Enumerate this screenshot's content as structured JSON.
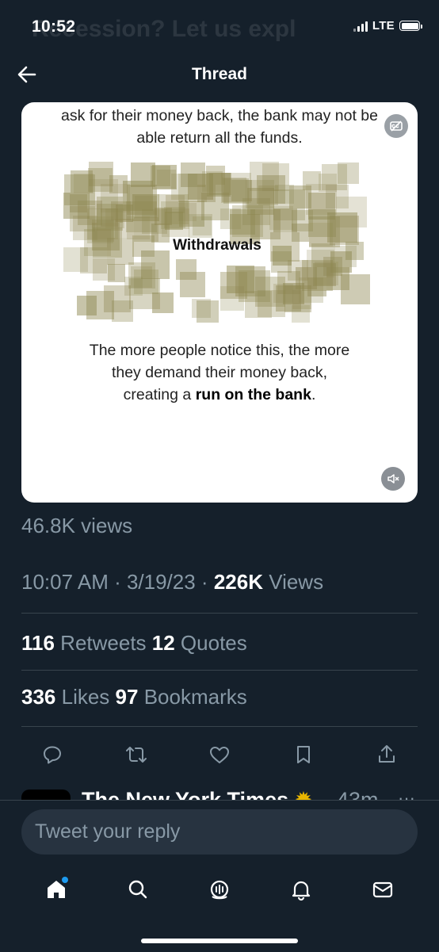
{
  "status": {
    "time": "10:52",
    "network": "LTE"
  },
  "header": {
    "title": "Thread"
  },
  "media": {
    "text_top": "ask for their money back, the bank may not be able return all the funds.",
    "grid_label": "Withdrawals",
    "text_bottom_1": "The more people notice this, the more they demand their money back, creating a ",
    "text_bottom_bold": "run on the bank",
    "text_bottom_end": "."
  },
  "stats": {
    "media_views": "46.8K views",
    "timestamp": "10:07 AM · 3/19/23 · ",
    "views_count": "226K",
    "views_label": " Views",
    "retweets_count": "116",
    "retweets_label": " Retweets ",
    "quotes_count": "12",
    "quotes_label": " Quotes",
    "likes_count": "336",
    "likes_label": " Likes ",
    "bookmarks_count": "97",
    "bookmarks_label": " Bookmarks"
  },
  "next_tweet": {
    "author": "The New York Times",
    "time": "43m",
    "more": "···"
  },
  "reply": {
    "placeholder": "Tweet your reply"
  },
  "icons": {
    "actions": [
      "reply-icon",
      "retweet-icon",
      "like-icon",
      "bookmark-icon",
      "share-icon"
    ],
    "nav": [
      "home-icon",
      "search-icon",
      "spaces-icon",
      "notifications-icon",
      "messages-icon"
    ]
  },
  "colors": {
    "background": "#15202b",
    "muted": "#8899a6",
    "accent": "#1d9bf0",
    "grid": "#8d8650"
  }
}
